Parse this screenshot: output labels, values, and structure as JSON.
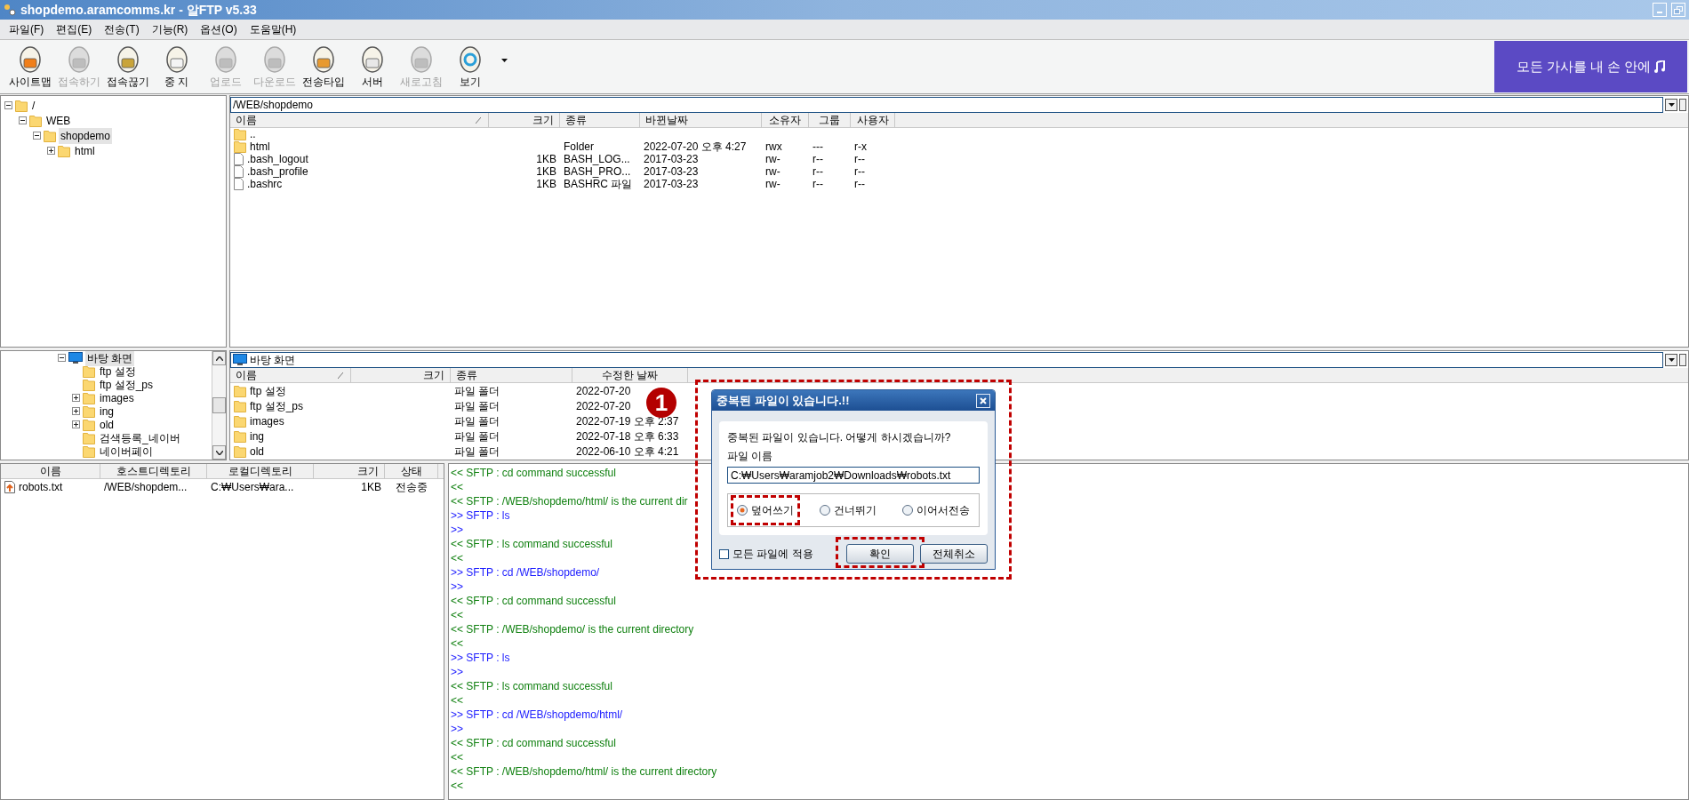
{
  "window": {
    "title": "shopdemo.aramcomms.kr - 알FTP v5.33"
  },
  "menu": [
    "파일(F)",
    "편집(E)",
    "전송(T)",
    "기능(R)",
    "옵션(O)",
    "도움말(H)"
  ],
  "toolbar": {
    "buttons": [
      {
        "label": "사이트맵",
        "kind": "sitemap",
        "disabled": false
      },
      {
        "label": "접속하기",
        "kind": "connect",
        "disabled": true
      },
      {
        "label": "접속끊기",
        "kind": "disconnect",
        "disabled": false
      },
      {
        "label": "중 지",
        "kind": "stop",
        "disabled": false
      },
      {
        "label": "업로드",
        "kind": "upload",
        "disabled": true
      },
      {
        "label": "다운로드",
        "kind": "download",
        "disabled": true
      },
      {
        "label": "전송타입",
        "kind": "transfer_type",
        "disabled": false
      },
      {
        "label": "서버",
        "kind": "server",
        "disabled": false
      },
      {
        "label": "새로고침",
        "kind": "refresh",
        "disabled": true
      },
      {
        "label": "보기",
        "kind": "view",
        "disabled": false
      }
    ],
    "ad": {
      "text": "모든 가사를 내 손 안에"
    }
  },
  "remote": {
    "tree": [
      {
        "label": "/",
        "expanded": true,
        "selected": false,
        "children": [
          {
            "label": "WEB",
            "expanded": true,
            "selected": false,
            "children": [
              {
                "label": "shopdemo",
                "expanded": true,
                "selected": true,
                "children": [
                  {
                    "label": "html",
                    "expanded": false,
                    "selected": false
                  }
                ]
              }
            ]
          }
        ]
      }
    ],
    "path": "/WEB/shopdemo",
    "columns": [
      "이름",
      "크기",
      "종류",
      "바뀐날짜",
      "소유자",
      "그룹",
      "사용자"
    ],
    "rows": [
      {
        "kind": "folder",
        "cells": [
          "..",
          null,
          null,
          null,
          null,
          null,
          null
        ]
      },
      {
        "kind": "folder",
        "cells": [
          "html",
          null,
          "Folder",
          "2022-07-20 오후 4:27",
          "rwx",
          "---",
          "r-x"
        ]
      },
      {
        "kind": "file",
        "cells": [
          ".bash_logout",
          "1KB",
          "BASH_LOG...",
          "2017-03-23",
          "rw-",
          "r--",
          "r--"
        ]
      },
      {
        "kind": "file",
        "cells": [
          ".bash_profile",
          "1KB",
          "BASH_PRO...",
          "2017-03-23",
          "rw-",
          "r--",
          "r--"
        ]
      },
      {
        "kind": "file",
        "cells": [
          ".bashrc",
          "1KB",
          "BASHRC 파일",
          "2017-03-23",
          "rw-",
          "r--",
          "r--"
        ]
      }
    ]
  },
  "local": {
    "tree": [
      {
        "label": "바탕 화면",
        "kind": "desktop",
        "expanded": true,
        "selected": true,
        "children": [
          {
            "label": "ftp 설정",
            "selected": false
          },
          {
            "label": "ftp 설정_ps",
            "selected": false
          },
          {
            "label": "images",
            "expanded": false,
            "selected": false
          },
          {
            "label": "ing",
            "expanded": false,
            "selected": false
          },
          {
            "label": "old",
            "expanded": false,
            "selected": false
          },
          {
            "label": "검색등록_네이버",
            "selected": false
          },
          {
            "label": "네이버페이",
            "selected": false
          }
        ]
      }
    ],
    "path": "바탕 화면",
    "columns": [
      "이름",
      "크기",
      "종류",
      "수정한 날짜"
    ],
    "rows": [
      {
        "kind": "folder",
        "cells": [
          "ftp 설정",
          null,
          "파일 폴더",
          "2022-07-20"
        ]
      },
      {
        "kind": "folder",
        "cells": [
          "ftp 설정_ps",
          null,
          "파일 폴더",
          "2022-07-20"
        ]
      },
      {
        "kind": "folder",
        "cells": [
          "images",
          null,
          "파일 폴더",
          "2022-07-19 오후 2:37"
        ]
      },
      {
        "kind": "folder",
        "cells": [
          "ing",
          null,
          "파일 폴더",
          "2022-07-18 오후 6:33"
        ]
      },
      {
        "kind": "folder",
        "cells": [
          "old",
          null,
          "파일 폴더",
          "2022-06-10 오후 4:21"
        ]
      }
    ]
  },
  "queue": {
    "columns": [
      "이름",
      "호스트디렉토리",
      "로컬디렉토리",
      "크기",
      "상태"
    ],
    "rows": [
      {
        "cells": [
          "robots.txt",
          "/WEB/shopdem...",
          "C:₩Users₩ara...",
          "1KB",
          "전송중"
        ]
      }
    ]
  },
  "log": [
    {
      "kind": "in",
      "text": "<< SFTP : cd command successful"
    },
    {
      "kind": "in",
      "text": "<<"
    },
    {
      "kind": "in",
      "text": "<< SFTP : /WEB/shopdemo/html/ is the current dir"
    },
    {
      "kind": "out",
      "text": ">> SFTP : ls"
    },
    {
      "kind": "out",
      "text": ">>"
    },
    {
      "kind": "in",
      "text": "<< SFTP : ls command successful"
    },
    {
      "kind": "in",
      "text": "<<"
    },
    {
      "kind": "out",
      "text": ">> SFTP : cd /WEB/shopdemo/"
    },
    {
      "kind": "out",
      "text": ">>"
    },
    {
      "kind": "in",
      "text": "<< SFTP : cd command successful"
    },
    {
      "kind": "in",
      "text": "<<"
    },
    {
      "kind": "in",
      "text": "<< SFTP : /WEB/shopdemo/ is the current directory"
    },
    {
      "kind": "in",
      "text": "<<"
    },
    {
      "kind": "out",
      "text": ">> SFTP : ls"
    },
    {
      "kind": "out",
      "text": ">>"
    },
    {
      "kind": "in",
      "text": "<< SFTP : ls command successful"
    },
    {
      "kind": "in",
      "text": "<<"
    },
    {
      "kind": "out",
      "text": ">> SFTP : cd /WEB/shopdemo/html/"
    },
    {
      "kind": "out",
      "text": ">>"
    },
    {
      "kind": "in",
      "text": "<< SFTP : cd command successful"
    },
    {
      "kind": "in",
      "text": "<<"
    },
    {
      "kind": "in",
      "text": "<< SFTP : /WEB/shopdemo/html/ is the current directory"
    },
    {
      "kind": "in",
      "text": "<<"
    }
  ],
  "dialog": {
    "title": "중복된 파일이 있습니다.!!",
    "message": "중복된 파일이 있습니다. 어떻게 하시겠습니까?",
    "field_label": "파일 이름",
    "filename": "C:₩Users₩aramjob2₩Downloads₩robots.txt",
    "options": [
      {
        "label": "덮어쓰기",
        "selected": true
      },
      {
        "label": "건너뛰기",
        "selected": false
      },
      {
        "label": "이어서전송",
        "selected": false
      }
    ],
    "apply_all": {
      "label": "모든 파일에 적용",
      "checked": false
    },
    "buttons": [
      "확인",
      "전체취소"
    ]
  },
  "annotation": {
    "badge": "1"
  }
}
